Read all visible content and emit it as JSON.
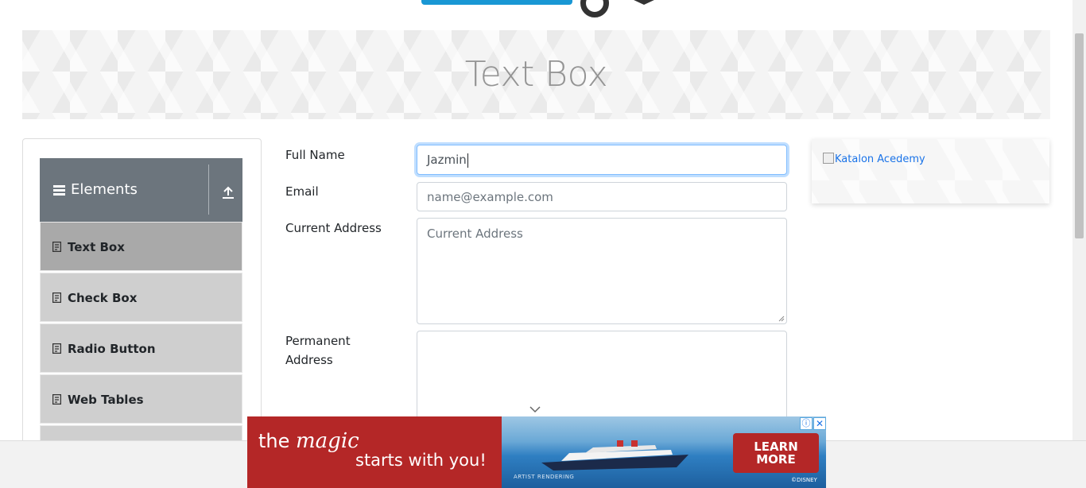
{
  "banner": {
    "title": "Text Box"
  },
  "sidebar": {
    "group_title": "Elements",
    "items": [
      {
        "label": "Text Box",
        "active": true
      },
      {
        "label": "Check Box",
        "active": false
      },
      {
        "label": "Radio Button",
        "active": false
      },
      {
        "label": "Web Tables",
        "active": false
      }
    ]
  },
  "form": {
    "full_name": {
      "label": "Full Name",
      "value": "Jazmin"
    },
    "email": {
      "label": "Email",
      "placeholder": "name@example.com"
    },
    "current_address": {
      "label": "Current Address",
      "placeholder": "Current Address"
    },
    "permanent_address": {
      "label_line1": "Permanent",
      "label_line2": "Address"
    }
  },
  "side_ad": {
    "alt_text": "Katalon Acedemy"
  },
  "bottom_ad": {
    "line1_prefix": "the",
    "line1_script": "magic",
    "line2": "starts with you!",
    "cta_line1": "LEARN",
    "cta_line2": "MORE",
    "fine_print": "ARTIST RENDERING",
    "brand": "©DISNEY",
    "adchoices_symbol": "ⓘ",
    "close_symbol": "✕"
  },
  "colors": {
    "accent": "#6c757d",
    "active_item": "#a9a9a9",
    "menu_item": "#cfcfcf",
    "ad_red": "#b42727",
    "focus_border": "#80bdff"
  },
  "icons": [
    "logo-gear-icon",
    "menu-icon",
    "collapse-up-icon",
    "document-icon",
    "chevron-down-icon",
    "adchoices-icon",
    "close-icon"
  ]
}
